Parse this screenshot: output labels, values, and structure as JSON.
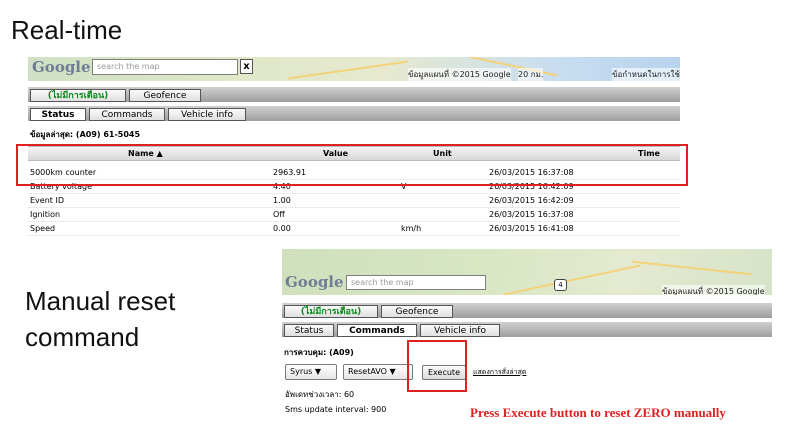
{
  "headings": {
    "realtime": "Real-time",
    "manual_line1": "Manual reset",
    "manual_line2": "command"
  },
  "top_panel": {
    "map": {
      "logo": "Google",
      "search_placeholder": "search the map",
      "clear": "x",
      "attribution": "ข้อมูลแผนที่ ©2015 Google",
      "scale": "20 กม.",
      "terms": "ข้อกำหนดในการใช้"
    },
    "top_tabs": [
      "(ไม่มีการเตือน)",
      "Geofence"
    ],
    "sub_tabs": [
      "Status",
      "Commands",
      "Vehicle info"
    ],
    "vehicle_line": "ข้อมูลล่าสุด: (A09) 61-5045",
    "table": {
      "headers": [
        "Name ▲",
        "Value",
        "Unit",
        "Time"
      ],
      "rows": [
        [
          "5000km counter",
          "2963.91",
          "",
          "26/03/2015 16:37:08"
        ],
        [
          "Battery voltage",
          "4.40",
          "V",
          "26/03/2015 16:42:09"
        ],
        [
          "Event ID",
          "1.00",
          "",
          "26/03/2015 16:42:09"
        ],
        [
          "Ignition",
          "Off",
          "",
          "26/03/2015 16:37:08"
        ],
        [
          "Speed",
          "0.00",
          "km/h",
          "26/03/2015 16:41:08"
        ]
      ]
    }
  },
  "bottom_panel": {
    "map": {
      "logo": "Google",
      "search_placeholder": "search the map",
      "route_number": "4",
      "attribution": "ข้อมูลแผนที่ ©2015 Google"
    },
    "top_tabs": [
      "(ไม่มีการเตือน)",
      "Geofence"
    ],
    "sub_tabs": [
      "Status",
      "Commands",
      "Vehicle info"
    ],
    "command_line": "การควบคุม: (A09)",
    "device_select": "Syrus",
    "command_select": "ResetAVO",
    "execute_label": "Execute",
    "history_link": "แสดงการสั่งล่าสุด",
    "update_interval": "อัพเดทช่วงเวลา: 60",
    "sms_interval": "Sms update interval: 900"
  },
  "annotation": "Press Execute button to reset ZERO manually",
  "colors": {
    "highlight": "#e02020",
    "alert_tab": "#0a8a1a",
    "note": "#e02020"
  }
}
